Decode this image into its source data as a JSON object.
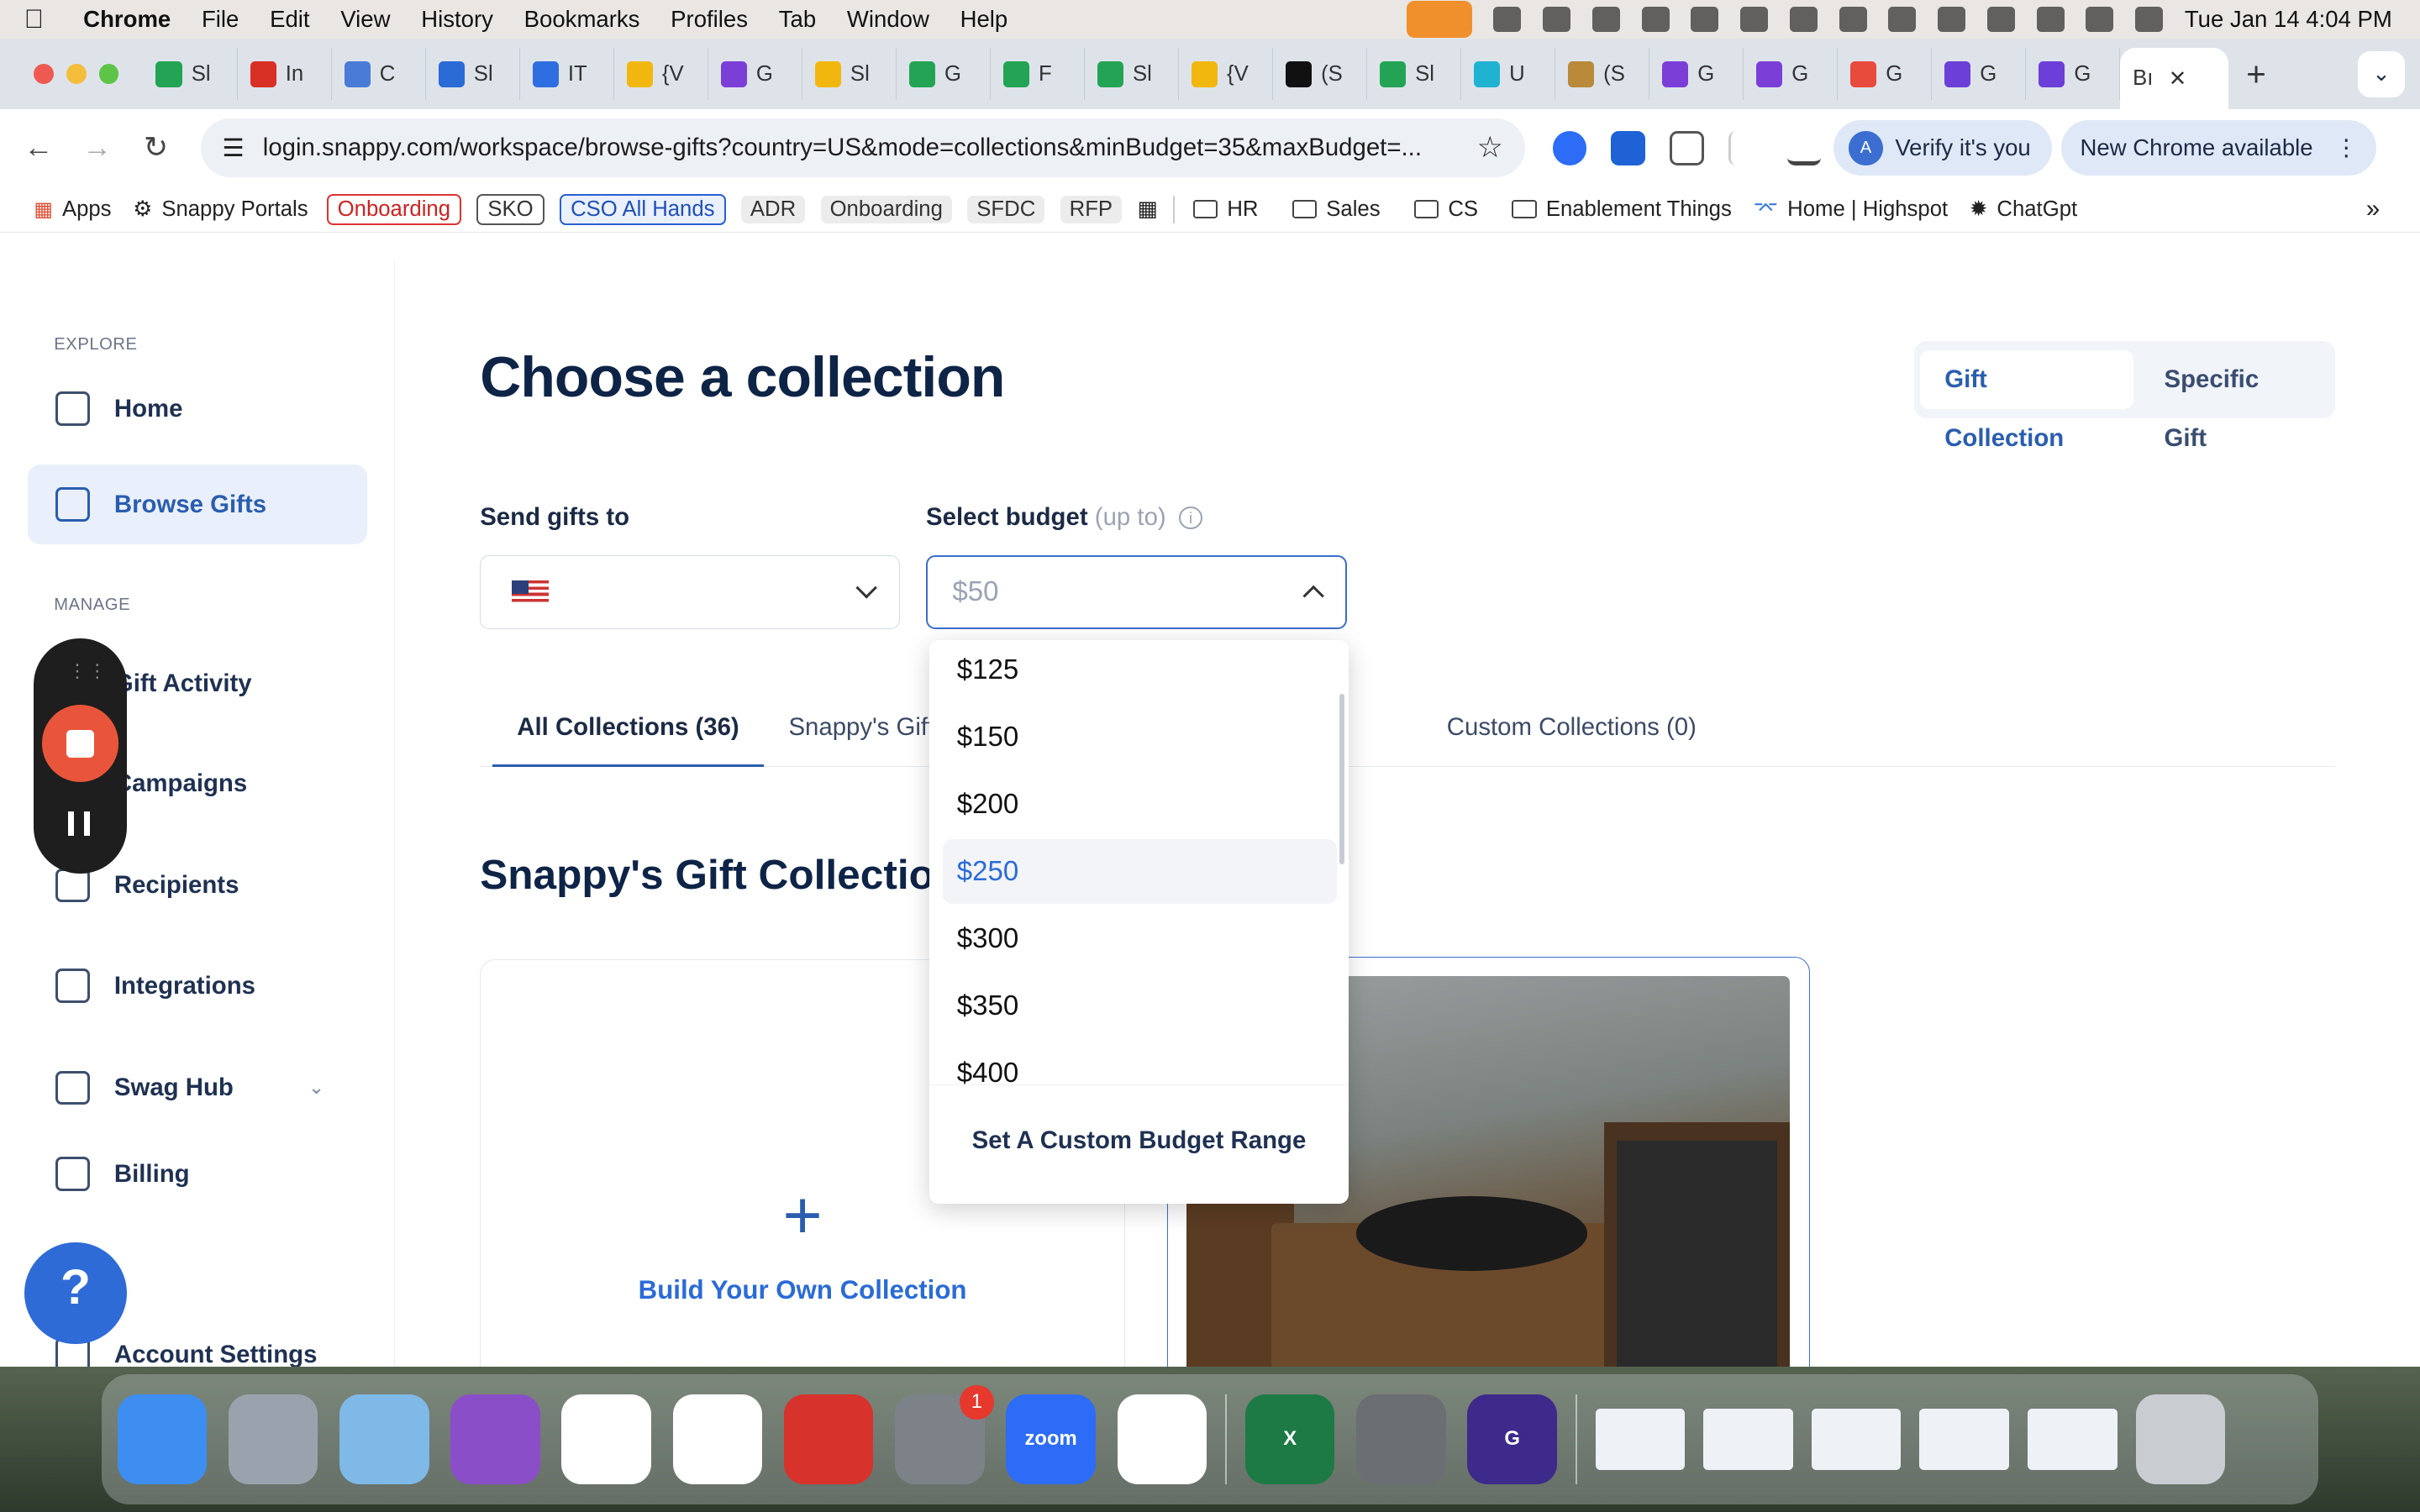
{
  "menubar": {
    "app": "Chrome",
    "items": [
      "File",
      "Edit",
      "View",
      "History",
      "Bookmarks",
      "Profiles",
      "Tab",
      "Window",
      "Help"
    ],
    "clock": "Tue Jan 14  4:04 PM"
  },
  "tabs": [
    {
      "label": "Sl",
      "color": "#23a455"
    },
    {
      "label": "In",
      "color": "#d93025"
    },
    {
      "label": "C",
      "color": "#4a7bd6"
    },
    {
      "label": "Sl",
      "color": "#2a6bd6"
    },
    {
      "label": "IT",
      "color": "#2f6ee0"
    },
    {
      "label": "{V",
      "color": "#f2b70f"
    },
    {
      "label": "G",
      "color": "#7b3fd8"
    },
    {
      "label": "Sl",
      "color": "#f2b70f"
    },
    {
      "label": "G",
      "color": "#23a455"
    },
    {
      "label": "F",
      "color": "#23a455"
    },
    {
      "label": "Sl",
      "color": "#23a455"
    },
    {
      "label": "{V",
      "color": "#f2b70f"
    },
    {
      "label": "(S",
      "color": "#111111"
    },
    {
      "label": "Sl",
      "color": "#23a455"
    },
    {
      "label": "U",
      "color": "#1fb3d1"
    },
    {
      "label": "(S",
      "color": "#b88a3a"
    },
    {
      "label": "G",
      "color": "#7b3fd8"
    },
    {
      "label": "G",
      "color": "#7b3fd8"
    },
    {
      "label": "G",
      "color": "#e84a3c"
    },
    {
      "label": "G",
      "color": "#6b3fd8"
    },
    {
      "label": "G",
      "color": "#6b3fd8"
    }
  ],
  "active_tab": {
    "label": "Bı",
    "close": "✕"
  },
  "toolbar": {
    "url": "login.snappy.com/workspace/browse-gifts?country=US&mode=collections&minBudget=35&maxBudget=...",
    "verify": "Verify it's you",
    "avatar_letter": "A",
    "new_chrome": "New Chrome available"
  },
  "bookmarks": {
    "apps": "Apps",
    "portals": "Snappy Portals",
    "pills": [
      {
        "label": "Onboarding",
        "style": "red"
      },
      {
        "label": "SKO",
        "style": "grayb"
      },
      {
        "label": "CSO All Hands",
        "style": "blue"
      },
      {
        "label": "ADR",
        "style": "gray"
      },
      {
        "label": "Onboarding",
        "style": "gray"
      },
      {
        "label": "SFDC",
        "style": "gray"
      },
      {
        "label": "RFP",
        "style": "gray"
      }
    ],
    "folders": [
      "HR",
      "Sales",
      "CS",
      "Enablement Things"
    ],
    "links": [
      "Home | Highspot",
      "ChatGpt"
    ]
  },
  "sidebar": {
    "explore_label": "EXPLORE",
    "manage_label": "MANAGE",
    "items": [
      {
        "label": "Home",
        "icon": "home-icon"
      },
      {
        "label": "Browse Gifts",
        "icon": "gift-icon",
        "active": true
      },
      {
        "label": "Gift Activity",
        "icon": "activity-icon"
      },
      {
        "label": "Campaigns",
        "icon": "campaign-icon"
      },
      {
        "label": "Recipients",
        "icon": "recipients-icon"
      },
      {
        "label": "Integrations",
        "icon": "integrations-icon"
      },
      {
        "label": "Swag Hub",
        "icon": "swag-icon"
      },
      {
        "label": "Billing",
        "icon": "billing-icon"
      },
      {
        "label": "Account Settings",
        "icon": "settings-icon"
      }
    ]
  },
  "main": {
    "title": "Choose a collection",
    "mode_toggle": [
      "Gift Collection",
      "Specific Gift"
    ],
    "send_to_label": "Send gifts to",
    "budget_label": "Select budget",
    "budget_muted": "(up to)",
    "budget_value": "$50",
    "tabs": [
      "All Collections (36)",
      "Snappy's Gift Co",
      "Custom Collections (0)"
    ],
    "section_title": "Snappy's Gift Collectio",
    "build_label": "Build Your Own Collection"
  },
  "budget_dropdown": {
    "options": [
      "$125",
      "$150",
      "$200",
      "$250",
      "$300",
      "$350",
      "$400"
    ],
    "highlighted": "$250",
    "custom": "Set A Custom Budget Range"
  },
  "dock": {
    "apps": [
      {
        "name": "finder",
        "color": "#3d8ef0"
      },
      {
        "name": "launchpad",
        "color": "#9aa3ad"
      },
      {
        "name": "gift",
        "color": "#7fb9e8"
      },
      {
        "name": "tulip",
        "color": "#8a4fc8"
      },
      {
        "name": "drive",
        "color": "#ffffff"
      },
      {
        "name": "chrome",
        "color": "#ffffff"
      },
      {
        "name": "dots",
        "color": "#d8322c"
      },
      {
        "name": "settings",
        "color": "#7d8288",
        "badge": "1"
      },
      {
        "name": "zoom",
        "color": "#2d6cf6",
        "label": "zoom"
      },
      {
        "name": "slack",
        "color": "#ffffff"
      }
    ],
    "apps2": [
      {
        "name": "excel",
        "color": "#1d7a45",
        "label": "X"
      },
      {
        "name": "calculator",
        "color": "#6b6e72"
      },
      {
        "name": "grammarly",
        "color": "#3d2a8a",
        "label": "G"
      }
    ]
  }
}
